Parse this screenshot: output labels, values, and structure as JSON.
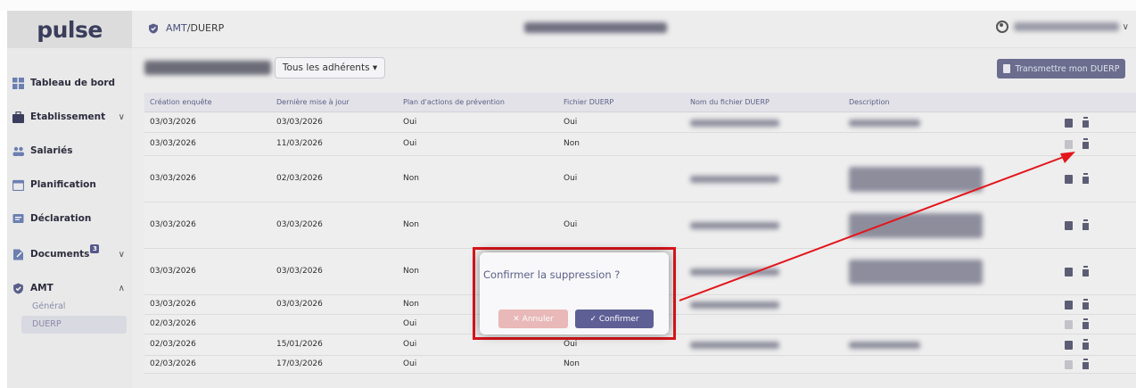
{
  "brand": {
    "logo": "pulse"
  },
  "header": {
    "breadcrumb_prefix": "AMT",
    "breadcrumb_sep": " / ",
    "breadcrumb_current": "DUERP",
    "user_chevron": "∨"
  },
  "sidebar": {
    "items": [
      {
        "label": "Tableau de bord",
        "icon": "dashboard-icon"
      },
      {
        "label": "Etablissement",
        "icon": "building-icon",
        "chevron": "∨"
      },
      {
        "label": "Salariés",
        "icon": "people-icon"
      },
      {
        "label": "Planification",
        "icon": "calendar-icon"
      },
      {
        "label": "Déclaration",
        "icon": "declaration-icon"
      },
      {
        "label": "Documents",
        "icon": "documents-icon",
        "chevron": "∨",
        "badge": "3"
      },
      {
        "label": "AMT",
        "icon": "shield-icon",
        "chevron": "∧"
      }
    ],
    "sub_items": [
      {
        "label": "Général"
      },
      {
        "label": "DUERP"
      }
    ]
  },
  "toolbar": {
    "filter_label": "Tous les adhérents ▾",
    "transmit_label": "Transmettre mon DUERP"
  },
  "table": {
    "columns": [
      "Création enquête",
      "Dernière mise à jour",
      "Plan d'actions de prévention",
      "Fichier DUERP",
      "Nom du fichier DUERP",
      "Description"
    ],
    "rows": [
      {
        "created": "03/03/2026",
        "updated": "03/03/2026",
        "plan": "Oui",
        "file": "Oui"
      },
      {
        "created": "03/03/2026",
        "updated": "11/03/2026",
        "plan": "Oui",
        "file": "Non"
      },
      {
        "created": "03/03/2026",
        "updated": "02/03/2026",
        "plan": "Non",
        "file": "Oui"
      },
      {
        "created": "03/03/2026",
        "updated": "03/03/2026",
        "plan": "Non",
        "file": "Oui"
      },
      {
        "created": "03/03/2026",
        "updated": "03/03/2026",
        "plan": "Non",
        "file": ""
      },
      {
        "created": "03/03/2026",
        "updated": "03/03/2026",
        "plan": "Non",
        "file": ""
      },
      {
        "created": "02/03/2026",
        "updated": "",
        "plan": "Oui",
        "file": ""
      },
      {
        "created": "02/03/2026",
        "updated": "15/01/2026",
        "plan": "Oui",
        "file": "Oui"
      },
      {
        "created": "02/03/2026",
        "updated": "17/03/2026",
        "plan": "Oui",
        "file": "Non"
      }
    ]
  },
  "modal": {
    "title": "Confirmer la suppression ?",
    "cancel_label": "✕ Annuler",
    "confirm_label": "✓ Confirmer"
  },
  "colors": {
    "accent": "#5e5f95",
    "annotation_red": "#d9151b",
    "cancel_bg": "#e9b8b8"
  }
}
